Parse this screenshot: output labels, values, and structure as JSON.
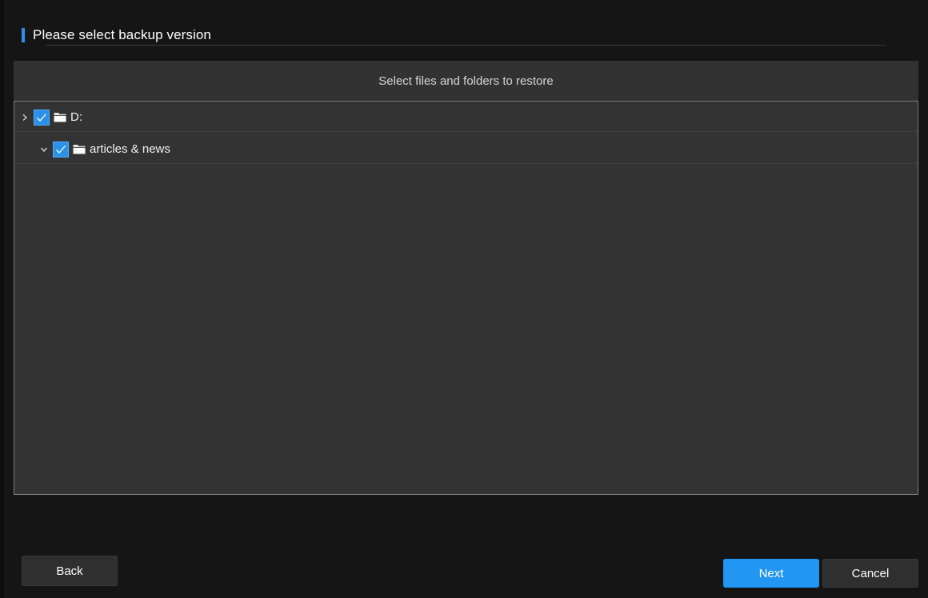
{
  "header": {
    "title": "Please select backup version",
    "accent_color": "#2e8fef"
  },
  "panel": {
    "caption": "Select files and folders to restore"
  },
  "tree": {
    "items": [
      {
        "label": "D:",
        "checked": true,
        "expander": "chevron-right-icon",
        "icon": "folder-icon"
      },
      {
        "label": "articles & news",
        "checked": true,
        "expander": "chevron-down-icon",
        "icon": "folder-icon"
      }
    ]
  },
  "footer": {
    "back_label": "Back",
    "next_label": "Next",
    "cancel_label": "Cancel",
    "primary_color": "#2196f3"
  }
}
